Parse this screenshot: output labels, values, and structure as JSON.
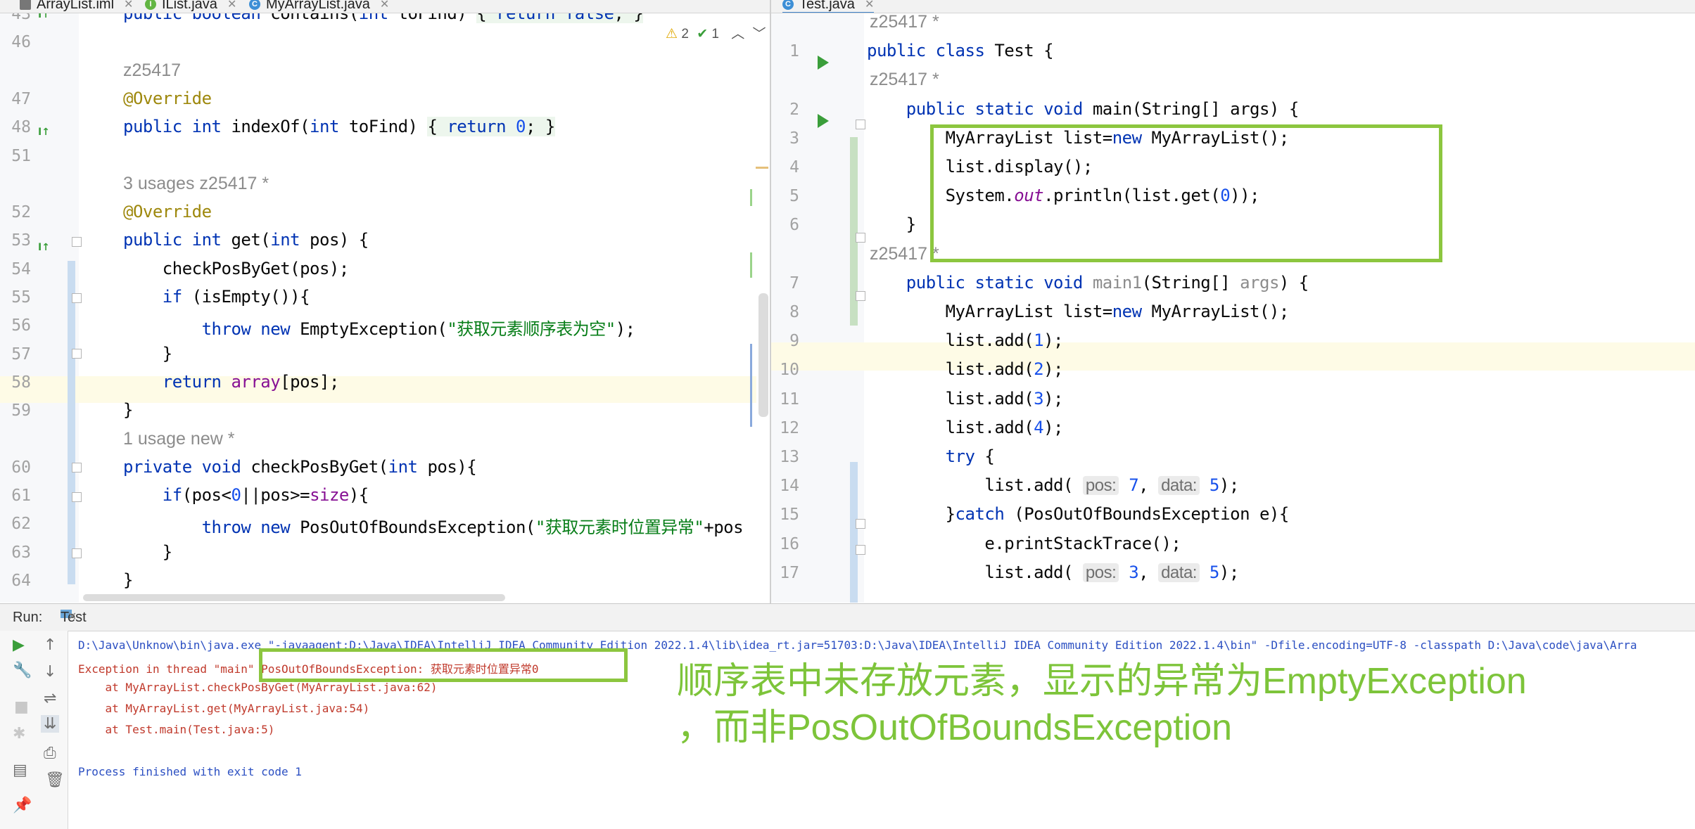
{
  "left_tabs": [
    {
      "label": "ArrayList.iml",
      "icon": "iml-file-icon"
    },
    {
      "label": "IList.java",
      "icon": "interface-icon"
    },
    {
      "label": "MyArrayList.java",
      "icon": "class-icon"
    }
  ],
  "right_tabs": [
    {
      "label": "Test.java",
      "icon": "class-icon"
    }
  ],
  "left_editor": {
    "inspection": {
      "warnings": "2",
      "weak": "1"
    },
    "lines": [
      {
        "num": "43",
        "html": "<span class='kw'>public boolean</span> contains(<span class='kw'>int</span> toFind) <span class='fold'>{ <span class='kw'>return false</span>; }</span>"
      },
      {
        "num": "46",
        "html": ""
      },
      {
        "num": "",
        "hint": "z25417"
      },
      {
        "num": "47",
        "html": "<span class='ann'>@Override</span>"
      },
      {
        "num": "48",
        "html": "<span class='kw'>public int</span> indexOf(<span class='kw'>int</span> toFind) <span class='fold'>{ <span class='kw'>return</span> <span class='num'>0</span>; }</span>"
      },
      {
        "num": "51",
        "html": ""
      },
      {
        "num": "",
        "hint": "3 usages   z25417 *"
      },
      {
        "num": "52",
        "html": "<span class='ann'>@Override</span>"
      },
      {
        "num": "53",
        "html": "<span class='kw'>public int</span> get(<span class='kw'>int</span> pos) {"
      },
      {
        "num": "54",
        "html": "    checkPosByGet(pos);"
      },
      {
        "num": "55",
        "html": "    <span class='kw'>if</span> (isEmpty()){"
      },
      {
        "num": "56",
        "html": "        <span class='kw'>throw new</span> EmptyException(<span class='str'>\"获取元素顺序表为空\"</span>);"
      },
      {
        "num": "57",
        "html": "    }"
      },
      {
        "num": "58",
        "html": "    <span class='kw'>return</span> <span class='fld'>array</span>[pos];"
      },
      {
        "num": "59",
        "html": "}"
      },
      {
        "num": "",
        "hint": "1 usage   new *"
      },
      {
        "num": "60",
        "html": "<span class='kw'>private void</span> checkPosByGet(<span class='kw'>int</span> pos){"
      },
      {
        "num": "61",
        "html": "    <span class='kw'>if</span>(pos&lt;<span class='num'>0</span>||pos&gt;=<span class='fld'>size</span>){"
      },
      {
        "num": "62",
        "html": "        <span class='kw'>throw new</span> PosOutOfBoundsException(<span class='str'>\"获取元素时位置异常\"</span>+pos"
      },
      {
        "num": "63",
        "html": "    }"
      },
      {
        "num": "64",
        "html": "}"
      }
    ]
  },
  "right_editor": {
    "lines": [
      {
        "num": "",
        "hint": "z25417 *"
      },
      {
        "num": "1",
        "html": "<span class='kw'>public class</span> Test {"
      },
      {
        "num": "",
        "hint": "z25417 *"
      },
      {
        "num": "2",
        "html": "    <span class='kw'>public static void</span> main(String[] args) {"
      },
      {
        "num": "3",
        "html": "        MyArrayList list=<span class='kw'>new</span> MyArrayList();"
      },
      {
        "num": "4",
        "html": "        list.display();"
      },
      {
        "num": "5",
        "html": "        System.<span class='stat'>out</span>.println(list.get(<span class='num'>0</span>));"
      },
      {
        "num": "6",
        "html": "    }"
      },
      {
        "num": "",
        "hint": "z25417 *"
      },
      {
        "num": "7",
        "html": "    <span class='kw'>public static void</span> <span class='param'>main1</span>(String[] <span class='param'>args</span>) {"
      },
      {
        "num": "8",
        "html": "        MyArrayList list=<span class='kw'>new</span> MyArrayList();"
      },
      {
        "num": "9",
        "html": "        list.add(<span class='num'>1</span>);"
      },
      {
        "num": "10",
        "html": "        list.add(<span class='num'>2</span>);"
      },
      {
        "num": "11",
        "html": "        list.add(<span class='num'>3</span>);"
      },
      {
        "num": "12",
        "html": "        list.add(<span class='num'>4</span>);"
      },
      {
        "num": "13",
        "html": "        <span class='kw'>try</span> {"
      },
      {
        "num": "14",
        "html": "            list.add( <span class='inlay'>pos:</span> <span class='num'>7</span>, <span class='inlay'>data:</span> <span class='num'>5</span>);"
      },
      {
        "num": "15",
        "html": "        }<span class='kw'>catch</span> (PosOutOfBoundsException e){"
      },
      {
        "num": "16",
        "html": "            e.printStackTrace();"
      },
      {
        "num": "17",
        "html": "            list.add( <span class='inlay'>pos:</span> <span class='num'>3</span>, <span class='inlay'>data:</span> <span class='num'>5</span>);"
      }
    ]
  },
  "run_panel": {
    "label": "Run:",
    "tab": "Test",
    "console": [
      {
        "text": "D:\\Java\\Unknow\\bin\\java.exe \"-javaagent:D:\\Java\\IDEA\\IntelliJ IDEA Community Edition 2022.1.4\\lib\\idea_rt.jar=51703:D:\\Java\\IDEA\\IntelliJ IDEA Community Edition 2022.1.4\\bin\" -Dfile.encoding=UTF-8 -classpath D:\\Java\\code\\java\\Arra",
        "style": "cmd"
      },
      {
        "text": "Exception in thread \"main\" PosOutOfBoundsException: 获取元素时位置异常0",
        "style": "err"
      },
      {
        "text": "    at MyArrayList.checkPosByGet(MyArrayList.java:62)",
        "style": "err"
      },
      {
        "text": "    at MyArrayList.get(MyArrayList.java:54)",
        "style": "err"
      },
      {
        "text": "    at Test.main(Test.java:5)",
        "style": "err"
      },
      {
        "text": "",
        "style": "plain"
      },
      {
        "text": "Process finished with exit code 1",
        "style": "plain"
      }
    ]
  },
  "annotation": {
    "line1": "顺序表中未存放元素，显示的异常为EmptyException",
    "line2": "，而非PosOutOfBoundsException"
  },
  "colors": {
    "highlight_box": "#8cc63f",
    "keyword": "#0033b3",
    "string": "#067d17",
    "error_text": "#c0392b"
  }
}
